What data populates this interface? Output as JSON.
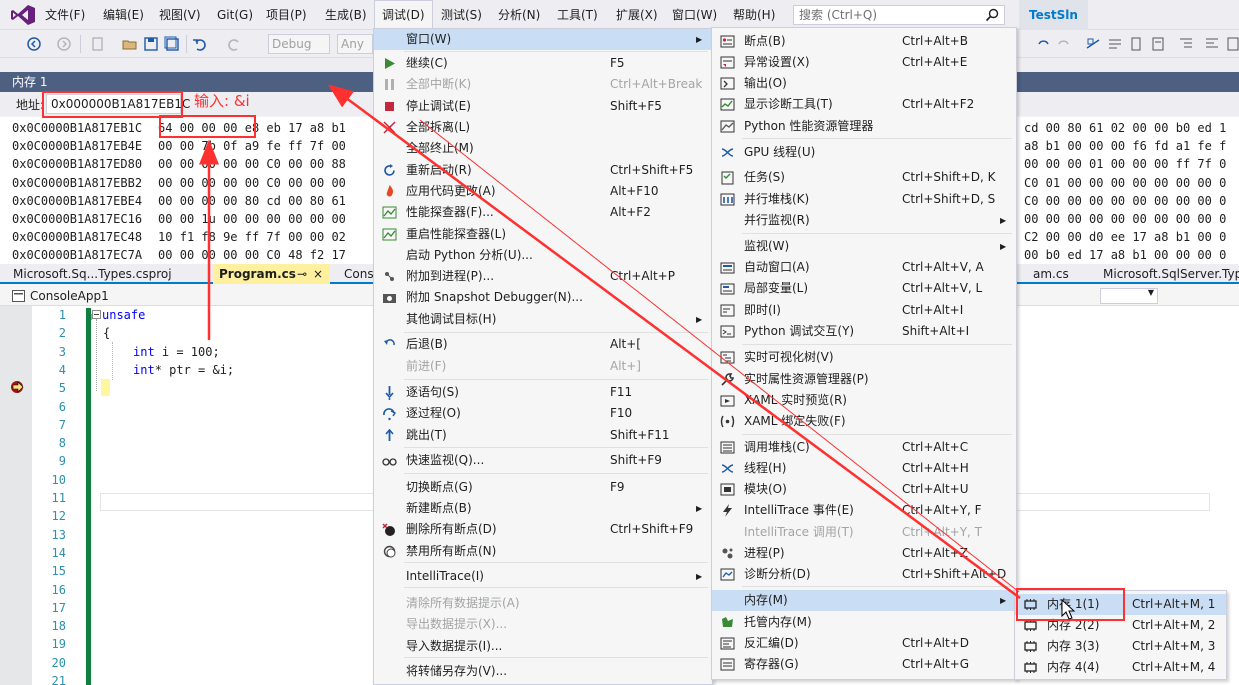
{
  "title_bar": {
    "menus": [
      "文件(F)",
      "编辑(E)",
      "视图(V)",
      "Git(G)",
      "项目(P)",
      "生成(B)",
      "调试(D)",
      "测试(S)",
      "分析(N)",
      "工具(T)",
      "扩展(X)",
      "窗口(W)",
      "帮助(H)"
    ],
    "active_menu_index": 6,
    "search_placeholder": "搜索 (Ctrl+Q)",
    "solution_name": "TestSln"
  },
  "toolbar": {
    "config_combo": "Debug",
    "platform_combo": "Any C"
  },
  "memory_window": {
    "title": "内存 1",
    "address_label": "地址:",
    "address_value": "0x000000B1A817EB1C",
    "rows": [
      {
        "addr": "0x0C0000B1A817EB1C",
        "bytes": "64 00 00 00 e8 eb 17 a8 b1",
        "tail": "cd 00 80 61 02 00 00 b0 ed 1"
      },
      {
        "addr": "0x0C0000B1A817EB4E",
        "bytes": "00 00 7b 0f a9 fe ff 7f 00",
        "tail": "a8 b1 00 00 00 f6 fd a1 fe f"
      },
      {
        "addr": "0x0C0000B1A817ED80",
        "bytes": "00 00 00 00 00 C0 00 00 88",
        "tail": "00 00 00 01 00 00 00 ff 7f 0"
      },
      {
        "addr": "0x0C0000B1A817EBB2",
        "bytes": "00 00 00 00 00 C0 00 00 00",
        "tail": "C0 01 00 00 00 00 00 00 00 0"
      },
      {
        "addr": "0x0C0000B1A817EBE4",
        "bytes": "00 00 00 00 80 cd 00 80 61",
        "tail": "C0 00 00 00 00 00 00 00 00 0"
      },
      {
        "addr": "0x0C0000B1A817EC16",
        "bytes": "00 00 1u 00 00 00 00 00 00",
        "tail": "00 00 00 00 00 00 00 00 00 0"
      },
      {
        "addr": "0x0C0000B1A817EC48",
        "bytes": "10 f1 f8 9e ff 7f 00 00 02",
        "tail": "C2 00 00 d0 ee 17 a8 b1 00 0"
      },
      {
        "addr": "0x0C0000B1A817EC7A",
        "bytes": "00 00 00 00 00 C0 48 f2 17",
        "tail": "00 b0 ed 17 a8 b1 00 00 00 0"
      }
    ]
  },
  "doc_tabs": {
    "tabs": [
      "Microsoft.Sq...Types.csproj",
      "Program.cs",
      "Conso",
      "am.cs",
      "Microsoft.SqlServer.Type"
    ],
    "pin_glyph": "⊸",
    "close_glyph": "×"
  },
  "editor": {
    "project_name": "ConsoleApp1",
    "line_numbers": [
      "1",
      "2",
      "3",
      "4",
      "5",
      "6",
      "7",
      "8",
      "9",
      "10",
      "11",
      "12",
      "13",
      "14",
      "15",
      "16",
      "17",
      "18",
      "19",
      "20",
      "21"
    ],
    "code": [
      {
        "line": 1,
        "keyword": "unsafe",
        "text": ""
      },
      {
        "line": 2,
        "keyword": "",
        "text": "{"
      },
      {
        "line": 3,
        "keyword": "int",
        "text": " i = 100;"
      },
      {
        "line": 4,
        "keyword": "int",
        "text": "* ptr = &i;"
      },
      {
        "line": 5,
        "keyword": "",
        "text": "}"
      }
    ]
  },
  "debug_menu": {
    "items": [
      {
        "label": "窗口(W)",
        "shortcut": "",
        "submenu": true,
        "highlight": true,
        "icon": "none"
      },
      {
        "label": "继续(C)",
        "shortcut": "F5",
        "icon": "play-icon"
      },
      {
        "label": "全部中断(K)",
        "shortcut": "Ctrl+Alt+Break",
        "disabled": true,
        "icon": "pause-icon"
      },
      {
        "label": "停止调试(E)",
        "shortcut": "Shift+F5",
        "icon": "stop-icon"
      },
      {
        "label": "全部拆离(L)",
        "shortcut": "",
        "icon": "detach-icon"
      },
      {
        "label": "全部终止(M)",
        "shortcut": "",
        "icon": "none"
      },
      {
        "label": "重新启动(R)",
        "shortcut": "Ctrl+Shift+F5",
        "icon": "restart-icon"
      },
      {
        "label": "应用代码更改(A)",
        "shortcut": "Alt+F10",
        "icon": "hot-reload-icon"
      },
      {
        "label": "性能探查器(F)...",
        "shortcut": "Alt+F2",
        "icon": "profiler-icon"
      },
      {
        "label": "重启性能探查器(L)",
        "shortcut": "",
        "icon": "profiler-icon"
      },
      {
        "label": "启动 Python 分析(U)...",
        "shortcut": "",
        "icon": "none"
      },
      {
        "label": "附加到进程(P)...",
        "shortcut": "Ctrl+Alt+P",
        "icon": "attach-icon"
      },
      {
        "label": "附加 Snapshot Debugger(N)...",
        "shortcut": "",
        "icon": "camera-icon"
      },
      {
        "label": "其他调试目标(H)",
        "shortcut": "",
        "submenu": true,
        "icon": "none"
      },
      {
        "label": "后退(B)",
        "shortcut": "Alt+[",
        "icon": "back-icon"
      },
      {
        "label": "前进(F)",
        "shortcut": "Alt+]",
        "disabled": true,
        "icon": "none"
      },
      {
        "label": "逐语句(S)",
        "shortcut": "F11",
        "icon": "step-into-icon"
      },
      {
        "label": "逐过程(O)",
        "shortcut": "F10",
        "icon": "step-over-icon"
      },
      {
        "label": "跳出(T)",
        "shortcut": "Shift+F11",
        "icon": "step-out-icon"
      },
      {
        "label": "快速监视(Q)...",
        "shortcut": "Shift+F9",
        "icon": "glasses-icon"
      },
      {
        "label": "切换断点(G)",
        "shortcut": "F9",
        "icon": "none"
      },
      {
        "label": "新建断点(B)",
        "shortcut": "",
        "submenu": true,
        "icon": "none"
      },
      {
        "label": "删除所有断点(D)",
        "shortcut": "Ctrl+Shift+F9",
        "icon": "delete-breakpoints-icon"
      },
      {
        "label": "禁用所有断点(N)",
        "shortcut": "",
        "icon": "disable-breakpoints-icon"
      },
      {
        "label": "IntelliTrace(I)",
        "shortcut": "",
        "submenu": true,
        "icon": "none"
      },
      {
        "label": "清除所有数据提示(A)",
        "shortcut": "",
        "disabled": true,
        "icon": "none"
      },
      {
        "label": "导出数据提示(X)...",
        "shortcut": "",
        "disabled": true,
        "icon": "none"
      },
      {
        "label": "导入数据提示(I)...",
        "shortcut": "",
        "icon": "none"
      },
      {
        "label": "将转储另存为(V)...",
        "shortcut": "",
        "icon": "none"
      }
    ]
  },
  "windows_submenu": {
    "items": [
      {
        "label": "断点(B)",
        "shortcut": "Ctrl+Alt+B",
        "icon": "breakpoints-icon"
      },
      {
        "label": "异常设置(X)",
        "shortcut": "Ctrl+Alt+E",
        "icon": "exception-icon"
      },
      {
        "label": "输出(O)",
        "shortcut": "",
        "icon": "output-icon"
      },
      {
        "label": "显示诊断工具(T)",
        "shortcut": "Ctrl+Alt+F2",
        "icon": "diagnostics-icon"
      },
      {
        "label": "Python 性能资源管理器",
        "shortcut": "",
        "icon": "python-perf-icon"
      },
      {
        "label": "GPU 线程(U)",
        "shortcut": "",
        "icon": "gpu-threads-icon"
      },
      {
        "label": "任务(S)",
        "shortcut": "Ctrl+Shift+D, K",
        "icon": "tasks-icon"
      },
      {
        "label": "并行堆栈(K)",
        "shortcut": "Ctrl+Shift+D, S",
        "icon": "parallel-stacks-icon"
      },
      {
        "label": "并行监视(R)",
        "shortcut": "",
        "submenu": true,
        "icon": "none"
      },
      {
        "label": "监视(W)",
        "shortcut": "",
        "submenu": true,
        "icon": "none"
      },
      {
        "label": "自动窗口(A)",
        "shortcut": "Ctrl+Alt+V, A",
        "icon": "autos-icon"
      },
      {
        "label": "局部变量(L)",
        "shortcut": "Ctrl+Alt+V, L",
        "icon": "locals-icon"
      },
      {
        "label": "即时(I)",
        "shortcut": "Ctrl+Alt+I",
        "icon": "immediate-icon"
      },
      {
        "label": "Python 调试交互(Y)",
        "shortcut": "Shift+Alt+I",
        "icon": "python-interactive-icon"
      },
      {
        "label": "实时可视化树(V)",
        "shortcut": "",
        "icon": "visual-tree-icon"
      },
      {
        "label": "实时属性资源管理器(P)",
        "shortcut": "",
        "icon": "wrench-icon"
      },
      {
        "label": "XAML 实时预览(R)",
        "shortcut": "",
        "icon": "xaml-preview-icon"
      },
      {
        "label": "XAML 绑定失败(F)",
        "shortcut": "",
        "icon": "xaml-binding-icon"
      },
      {
        "label": "调用堆栈(C)",
        "shortcut": "Ctrl+Alt+C",
        "icon": "call-stack-icon"
      },
      {
        "label": "线程(H)",
        "shortcut": "Ctrl+Alt+H",
        "icon": "threads-icon"
      },
      {
        "label": "模块(O)",
        "shortcut": "Ctrl+Alt+U",
        "icon": "modules-icon"
      },
      {
        "label": "IntelliTrace 事件(E)",
        "shortcut": "Ctrl+Alt+Y, F",
        "icon": "lightning-icon"
      },
      {
        "label": "IntelliTrace 调用(T)",
        "shortcut": "Ctrl+Alt+Y, T",
        "disabled": true,
        "icon": "none"
      },
      {
        "label": "进程(P)",
        "shortcut": "Ctrl+Alt+Z",
        "icon": "processes-icon"
      },
      {
        "label": "诊断分析(D)",
        "shortcut": "Ctrl+Shift+Alt+D",
        "icon": "diagnostic-analysis-icon"
      },
      {
        "label": "内存(M)",
        "shortcut": "",
        "submenu": true,
        "highlight": true,
        "icon": "none"
      },
      {
        "label": "托管内存(M)",
        "shortcut": "",
        "icon": "managed-memory-icon"
      },
      {
        "label": "反汇编(D)",
        "shortcut": "Ctrl+Alt+D",
        "icon": "disassembly-icon"
      },
      {
        "label": "寄存器(G)",
        "shortcut": "Ctrl+Alt+G",
        "icon": "registers-icon"
      }
    ]
  },
  "memory_submenu": {
    "items": [
      {
        "label": "内存 1(1)",
        "shortcut": "Ctrl+Alt+M, 1",
        "highlight": true
      },
      {
        "label": "内存 2(2)",
        "shortcut": "Ctrl+Alt+M, 2"
      },
      {
        "label": "内存 3(3)",
        "shortcut": "Ctrl+Alt+M, 3"
      },
      {
        "label": "内存 4(4)",
        "shortcut": "Ctrl+Alt+M, 4"
      }
    ]
  },
  "annotation": {
    "text": "输入: &i",
    "color": "#ff0000"
  },
  "colors": {
    "accent": "#007acc",
    "menu_highlight": "#c9def5",
    "memory_caption": "#4d6082",
    "change_bar": "#108040"
  }
}
